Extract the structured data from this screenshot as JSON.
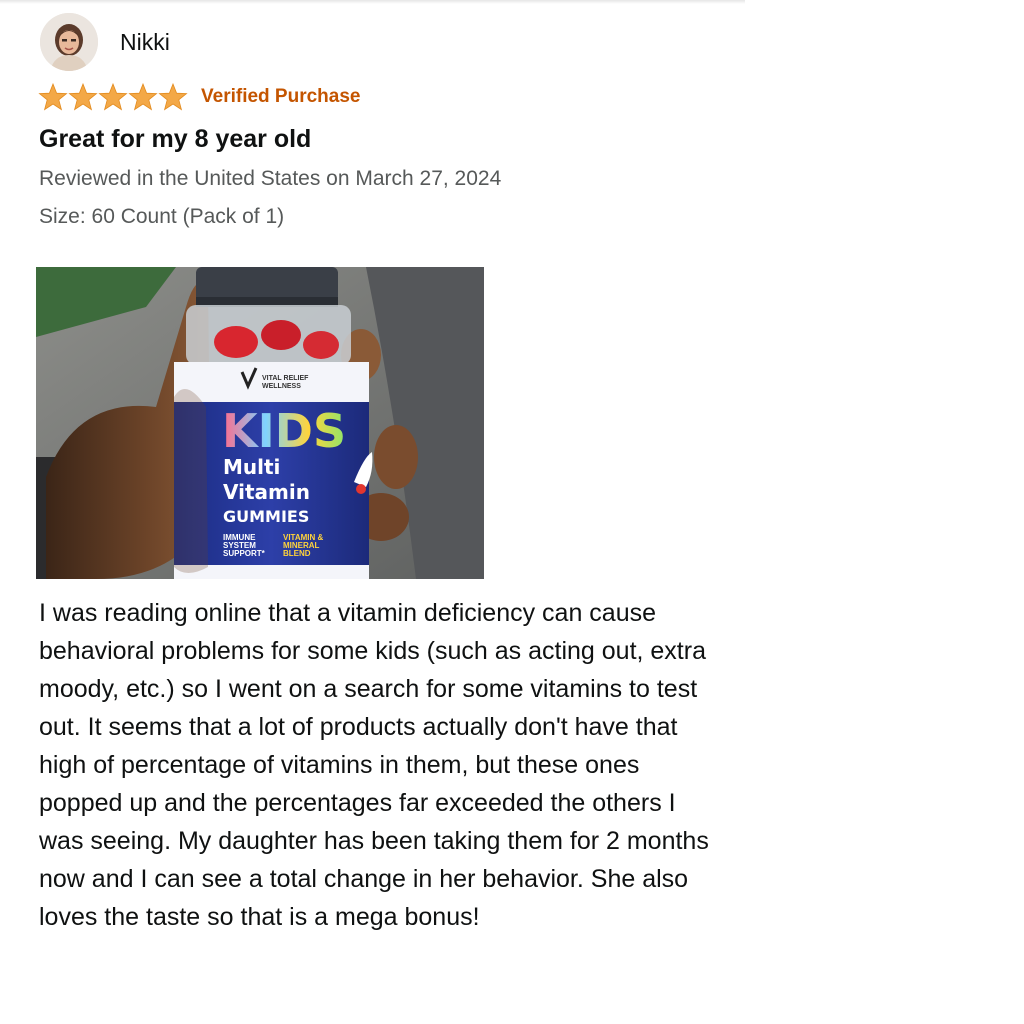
{
  "review": {
    "reviewer": {
      "name": "Nikki",
      "avatar_icon": "user-avatar-photo"
    },
    "rating": {
      "value": 5,
      "max": 5,
      "color": "#f3a847",
      "star_icon": "star-icon"
    },
    "badge": {
      "text": "Verified Purchase",
      "color": "#c45500"
    },
    "title": "Great for my 8 year old",
    "date_line": "Reviewed in the United States on March 27, 2024",
    "variant": "Size: 60 Count (Pack of 1)",
    "photo": {
      "bottle_brand": "VITAL RELIEF WELLNESS",
      "bottle_kids": "KIDS",
      "bottle_line1": "Multi",
      "bottle_line2": "Vitamin",
      "bottle_line3": "GUMMIES",
      "bottle_claim_left": "IMMUNE SYSTEM SUPPORT*",
      "bottle_claim_right": "VITAMIN & MINERAL BLEND"
    },
    "body": "I was reading online that a vitamin deficiency can cause behavioral problems for some kids (such as acting out, extra moody, etc.) so I went on a search for some vitamins to test out. It seems that a lot of products actually don't have that high of percentage of vitamins in them, but these ones popped up and the percentages far exceeded the others I was seeing. My daughter has been taking them for 2 months now and I can see a total change in her behavior. She also loves the taste so that is a mega bonus!"
  }
}
